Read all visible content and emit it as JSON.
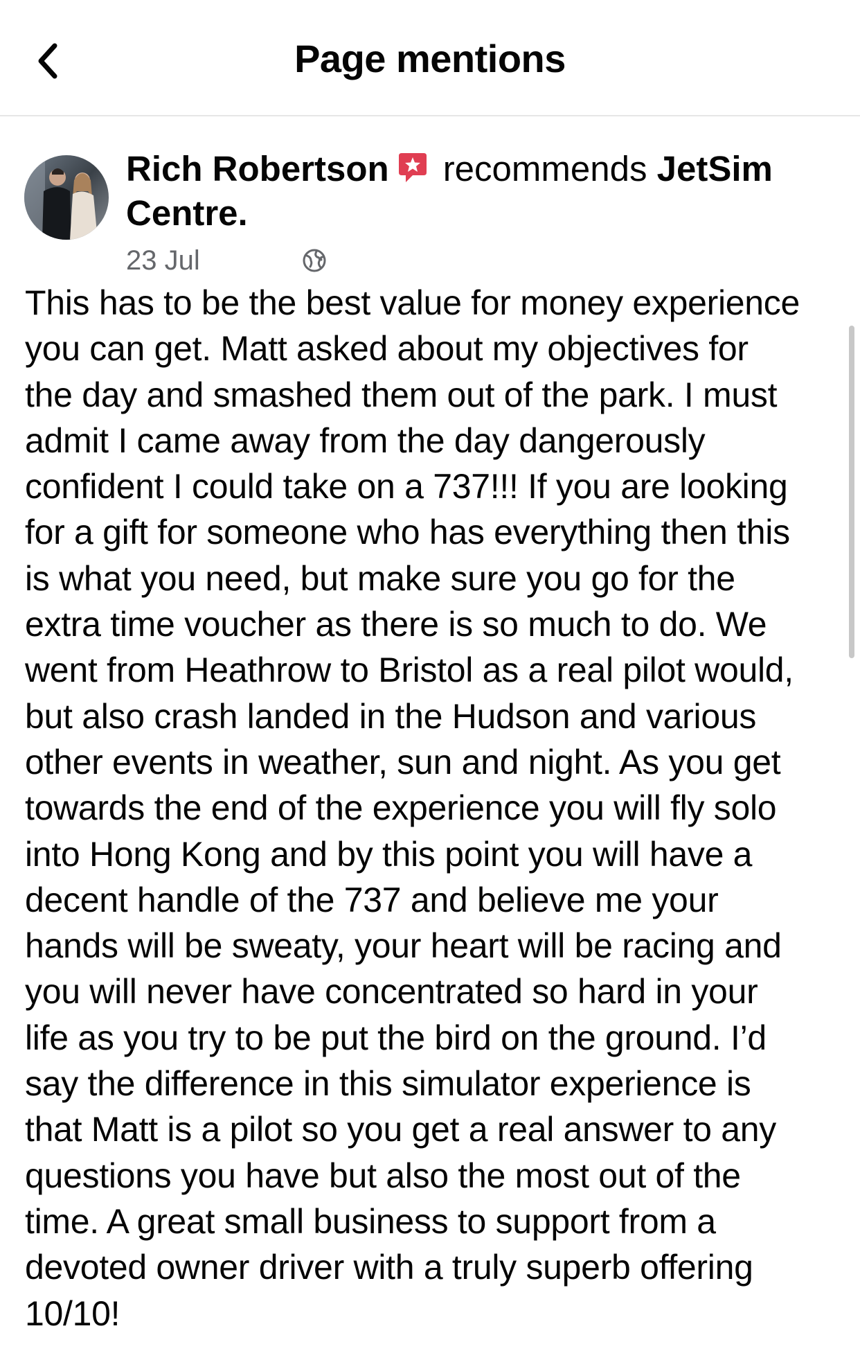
{
  "header": {
    "title": "Page mentions",
    "back_icon": "chevron-left-icon"
  },
  "post": {
    "author": "Rich Robertson",
    "badge_icon": "recommend-star-icon",
    "badge_color": "#e03e52",
    "verb": "recommends",
    "page_name": "JetSim Centre.",
    "date": "23 Jul",
    "privacy_icon": "globe-icon",
    "text": "This has to be the best value for money experience\nyou can get. Matt asked about my objectives for\nthe day and smashed them out of the park. I must\nadmit I came away from the day dangerously\nconfident I could take on a 737!!! If you are looking\nfor a gift for someone who has everything then this\nis what you need, but make sure you go for the\nextra time voucher as there is so much to do. We\nwent from Heathrow to Bristol as a real pilot would,\nbut also crash landed in the Hudson and various\nother events in weather, sun and night. As you get\ntowards the end of the experience you will fly solo\ninto Hong Kong and by this point you will have a\ndecent handle of the 737 and believe me your\nhands will be sweaty, your heart will be racing and\nyou will never have concentrated so hard in your\nlife as you try to be put the bird on the ground. I’d\nsay the difference in this simulator experience is\nthat Matt is a pilot so you get a real answer to any\nquestions you have but also the most out of the\ntime. A great small business to support from a\ndevoted owner driver with a truly superb offering\n10/10!"
  }
}
